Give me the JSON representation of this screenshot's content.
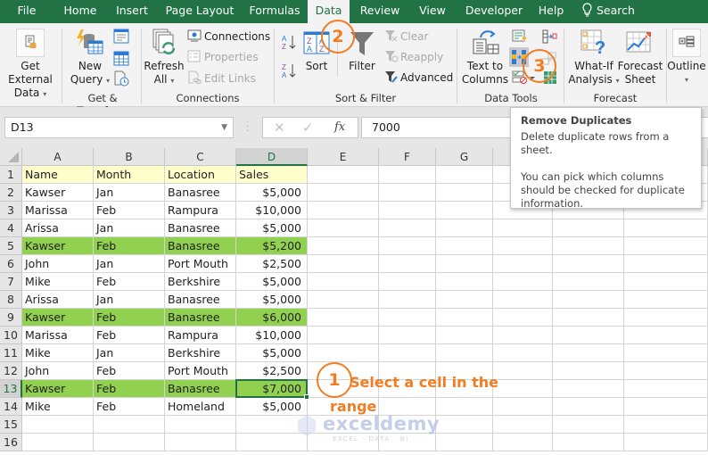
{
  "ribbon_tabs": [
    "File",
    "Home",
    "Insert",
    "Page Layout",
    "Formulas",
    "Data",
    "Review",
    "View",
    "Developer",
    "Help"
  ],
  "active_tab": "Data",
  "search_label": "Search",
  "groups": {
    "get_transform": {
      "label": "Get & Transform",
      "get_external_data": "Get External\nData",
      "get_external_line1": "Get External",
      "get_external_line2": "Data",
      "new_query_line1": "New",
      "new_query_line2": "Query"
    },
    "connections": {
      "label": "Connections",
      "refresh_line1": "Refresh",
      "refresh_line2": "All",
      "connections": "Connections",
      "properties": "Properties",
      "edit_links": "Edit Links"
    },
    "sort_filter": {
      "label": "Sort & Filter",
      "sort": "Sort",
      "filter": "Filter",
      "clear": "Clear",
      "reapply": "Reapply",
      "advanced": "Advanced"
    },
    "data_tools": {
      "label": "Data Tools",
      "text_to_columns_line1": "Text to",
      "text_to_columns_line2": "Columns"
    },
    "forecast": {
      "label": "Forecast",
      "what_if_line1": "What-If",
      "what_if_line2": "Analysis",
      "forecast_sheet_line1": "Forecast",
      "forecast_sheet_line2": "Sheet"
    },
    "outline": {
      "label": "Outline"
    }
  },
  "formula_bar": {
    "name_box": "D13",
    "fx": "fx",
    "value": "7000"
  },
  "columns": [
    "A",
    "B",
    "C",
    "D",
    "E",
    "F",
    "G"
  ],
  "selected_column": "D",
  "selected_row": 13,
  "rows": [
    {
      "n": "1",
      "cells": [
        "Name",
        "Month",
        "Location",
        "Sales"
      ],
      "type": "header"
    },
    {
      "n": "2",
      "cells": [
        "Kawser",
        "Jan",
        "Banasree",
        "$5,000"
      ]
    },
    {
      "n": "3",
      "cells": [
        "Marissa",
        "Feb",
        "Rampura",
        "$10,000"
      ]
    },
    {
      "n": "4",
      "cells": [
        "Arissa",
        "Jan",
        "Banasree",
        "$5,000"
      ]
    },
    {
      "n": "5",
      "cells": [
        "Kawser",
        "Feb",
        "Banasree",
        "$5,200"
      ],
      "type": "highlight"
    },
    {
      "n": "6",
      "cells": [
        "John",
        "Jan",
        "Port Mouth",
        "$2,500"
      ]
    },
    {
      "n": "7",
      "cells": [
        "Mike",
        "Feb",
        "Berkshire",
        "$5,000"
      ]
    },
    {
      "n": "8",
      "cells": [
        "Arissa",
        "Jan",
        "Banasree",
        "$5,000"
      ]
    },
    {
      "n": "9",
      "cells": [
        "Kawser",
        "Feb",
        "Banasree",
        "$6,000"
      ],
      "type": "highlight"
    },
    {
      "n": "10",
      "cells": [
        "Marissa",
        "Feb",
        "Rampura",
        "$10,000"
      ]
    },
    {
      "n": "11",
      "cells": [
        "Mike",
        "Jan",
        "Berkshire",
        "$5,000"
      ]
    },
    {
      "n": "12",
      "cells": [
        "John",
        "Feb",
        "Port Mouth",
        "$2,500"
      ]
    },
    {
      "n": "13",
      "cells": [
        "Kawser",
        "Feb",
        "Banasree",
        "$7,000"
      ],
      "type": "highlight"
    },
    {
      "n": "14",
      "cells": [
        "Mike",
        "Feb",
        "Homeland",
        "$5,000"
      ]
    },
    {
      "n": "15",
      "cells": [
        "",
        "",
        "",
        ""
      ]
    },
    {
      "n": "16",
      "cells": [
        "",
        "",
        "",
        ""
      ]
    }
  ],
  "tooltip": {
    "title": "Remove Duplicates",
    "line1": "Delete duplicate rows from a sheet.",
    "line2": "You can pick which columns should be checked for duplicate information."
  },
  "callouts": {
    "step1_num": "1",
    "step1_text": "Select a cell in the",
    "step1_text2": "range",
    "step2_num": "2",
    "step3_num": "3"
  },
  "watermark": {
    "brand": "exceldemy",
    "tagline": "EXCEL · DATA · BI"
  },
  "colors": {
    "excel_green": "#217346",
    "highlight_row": "#92d050",
    "header_fill": "#ffffcc",
    "callout_orange": "#f47c20"
  }
}
